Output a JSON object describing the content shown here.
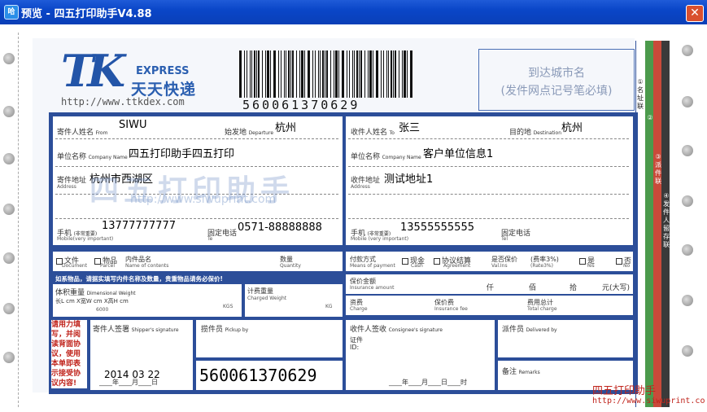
{
  "window": {
    "title": "预览 - 四五打印助手V4.88",
    "icon": "app-icon",
    "close_glyph": "✕"
  },
  "logo": {
    "mark": "TK",
    "express": "EXPRESS",
    "brand_cn": "天天快递",
    "url": "http://www.ttkdex.com"
  },
  "barcode": {
    "number": "560061370629"
  },
  "destination": {
    "line1": "到达城市名",
    "line2": "(发件网点记号笔必填)"
  },
  "sender": {
    "name_label": "寄件人姓名",
    "name_sub": "From",
    "name": "SIWU",
    "origin_label": "始发地",
    "origin_sub": "Departure",
    "origin": "杭州",
    "company_label": "单位名称",
    "company_sub": "Company Name",
    "company": "四五打印助手四五打印",
    "address_label": "寄件地址",
    "address_sub": "Address",
    "address": "杭州市西湖区",
    "mobile_label": "手机",
    "mobile_note": "(非常重要)",
    "mobile_sub": "Mobile(very important)",
    "mobile": "13777777777",
    "phone_label": "固定电话",
    "phone_sub": "Te",
    "phone": "0571-88888888"
  },
  "recipient": {
    "name_label": "收件人姓名",
    "name_sub": "To",
    "name": "张三",
    "dest_label": "目的地",
    "dest_sub": "Destination",
    "dest": "杭州",
    "company_label": "单位名称",
    "company_sub": "Company Name",
    "company": "客户单位信息1",
    "address_label": "收件地址",
    "address_sub": "Address",
    "address": "测试地址1",
    "mobile_label": "手机",
    "mobile_note": "(非常重要)",
    "mobile_sub": "Mobile (very important)",
    "mobile": "13555555555",
    "phone_label": "固定电话",
    "phone_sub": "Tel"
  },
  "items": {
    "doc_label": "文件",
    "doc_sub": "Document",
    "parcel_label": "物品",
    "parcel_sub": "Parcel",
    "contents_label": "内件品名",
    "contents_sub": "Name of contents",
    "qty_label": "数量",
    "qty_sub": "Quantity",
    "notice": "如系物品，请据实填写内件名称及数量，贵重物品请务必保价!",
    "weight_label": "体积重量",
    "weight_sub": "Dimensional Weight",
    "dims": "长L      cm  X宽W      cm  X高H      cm",
    "divisor": "6000",
    "kgs": "KGS",
    "charged_label": "计费重量",
    "charged_sub": "Charged Weight",
    "kg": "KG"
  },
  "payment": {
    "method_label": "付款方式",
    "method_sub": "Means of payment",
    "cash_label": "现金",
    "cash_sub": "Cash",
    "agreement_label": "协议结算",
    "agreement_sub": "Agreement",
    "insure_label": "是否保价",
    "insure_sub": "Val.Ins",
    "rate_label": "(费率3%)",
    "rate_sub": "(Rate3%)",
    "yes_label": "是",
    "yes_sub": "Yes",
    "no_label": "否",
    "no_sub": "No",
    "ins_amount_label": "保价金额",
    "ins_amount_sub": "Insurance amount",
    "amount_units": [
      "仟",
      "佰",
      "拾",
      "元(大写)"
    ],
    "freight_label": "资费",
    "freight_sub": "Charge",
    "ins_fee_label": "保价费",
    "ins_fee_sub": "Insurance fee",
    "total_label": "费用总计",
    "total_sub": "Total charge"
  },
  "signatures": {
    "warning": "请用力填写，并阅读背面协议，使用本单即表示接受协议内容!",
    "shipper_label": "寄件人签署",
    "shipper_sub": "Shipper's signature",
    "date": "2014  03  22",
    "date_units": "____年____月____日",
    "pickup_label": "揽件员",
    "pickup_sub": "Pickup by",
    "waybill": "560061370629",
    "consignee_label": "收件人签收",
    "consignee_sub": "Consignee's signature",
    "id_label": "证件",
    "id_sub": "ID:",
    "consignee_date": "____年____月____日____时",
    "courier_label": "派件员",
    "courier_sub": "Delivered by",
    "remarks_label": "备注",
    "remarks_sub": "Remarks"
  },
  "side_strips": {
    "strip1": "①名址联",
    "strip2": "②",
    "strip3": "③派件联",
    "strip4": "④发件人留存联"
  },
  "watermark": {
    "text": "四五打印助手",
    "url": "http://www.siwuprint.com"
  },
  "footer": {
    "brand": "四五打印助手",
    "url": "http://www.siwuprint.co"
  }
}
